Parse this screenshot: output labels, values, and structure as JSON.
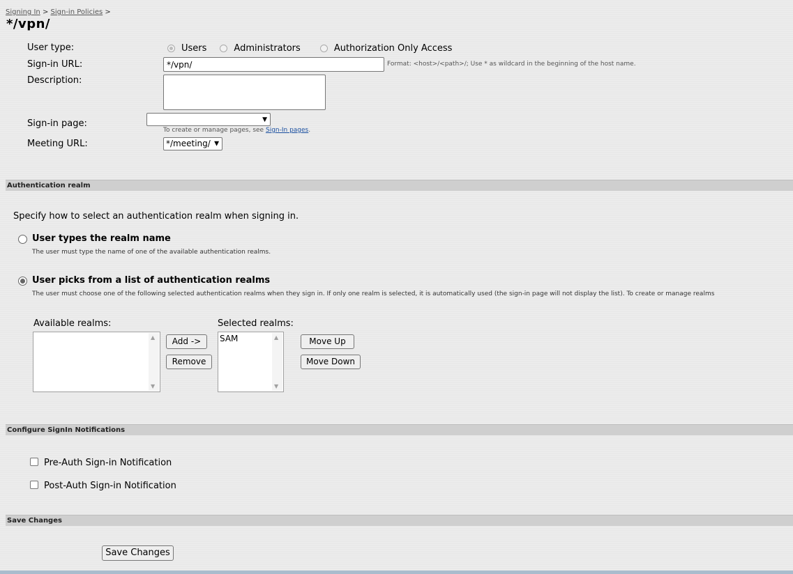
{
  "breadcrumb": {
    "link1": "Signing In",
    "sep1": ">",
    "link2": "Sign-in Policies",
    "sep2": ">"
  },
  "page_title": "*/vpn/",
  "form": {
    "user_type_label": "User type:",
    "user_type_options": [
      "Users",
      "Administrators",
      "Authorization Only Access"
    ],
    "user_type_selected": "Users",
    "signin_url_label": "Sign-in URL:",
    "signin_url_value": "*/vpn/",
    "signin_url_hint": "Format: <host>/<path>/;   Use * as wildcard in the beginning of the host name.",
    "description_label": "Description:",
    "description_value": "",
    "signin_page_label": "Sign-in page:",
    "signin_page_value": "",
    "signin_page_hint_prefix": "To create or manage pages, see",
    "signin_page_hint_link": "Sign-In pages",
    "signin_page_hint_suffix": ".",
    "meeting_url_label": "Meeting URL:",
    "meeting_url_value": "*/meeting/"
  },
  "auth_realm": {
    "section_title": "Authentication realm",
    "intro": "Specify how to select an authentication realm when signing in.",
    "option1_title": "User types the realm name",
    "option1_desc": "The user must type the name of one of the available authentication realms.",
    "option2_title": "User picks from a list of authentication realms",
    "option2_desc": "The user must choose one of the following selected authentication realms when they sign in. If only one realm is selected, it is automatically used (the sign-in page will not display the list). To create or manage realms",
    "selected_option": 2,
    "available_label": "Available realms:",
    "selected_label": "Selected realms:",
    "selected_items": [
      "SAM"
    ],
    "add_button": "Add ->",
    "remove_button": "Remove",
    "move_up_button": "Move Up",
    "move_down_button": "Move Down"
  },
  "notifications": {
    "section_title": "Configure SignIn Notifications",
    "pre_auth_label": "Pre-Auth Sign-in Notification",
    "post_auth_label": "Post-Auth Sign-in Notification"
  },
  "save": {
    "section_title": "Save Changes",
    "button_label": "Save Changes"
  }
}
